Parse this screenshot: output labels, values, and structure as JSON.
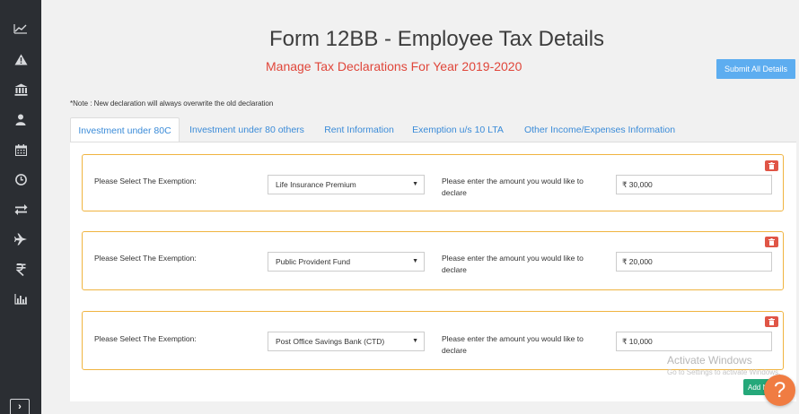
{
  "sidebar": {
    "icons": [
      "chart-line-icon",
      "warning-icon",
      "bank-icon",
      "user-icon",
      "calendar-icon",
      "clock-icon",
      "exchange-icon",
      "plane-icon",
      "rupee-icon",
      "bar-chart-icon"
    ],
    "toggle_glyph": "›"
  },
  "header": {
    "title": "Form 12BB - Employee Tax Details",
    "subtitle": "Manage Tax Declarations For Year 2019-2020",
    "submit_label": "Submit All Details"
  },
  "note": "*Note : New declaration will always overwrite the old declaration",
  "tabs": [
    {
      "label": "Investment under 80C",
      "active": true
    },
    {
      "label": "Investment under 80 others",
      "active": false
    },
    {
      "label": "Rent Information",
      "active": false
    },
    {
      "label": "Exemption u/s 10 LTA",
      "active": false
    },
    {
      "label": "Other Income/Expenses Information",
      "active": false
    }
  ],
  "declarations": [
    {
      "label": "Please Select The Exemption:",
      "selected": "Life Insurance Premium",
      "prompt": "Please enter the amount you would like to declare",
      "amount": "₹ 30,000"
    },
    {
      "label": "Please Select The Exemption:",
      "selected": "Public Provident Fund",
      "prompt": "Please enter the amount you would like to declare",
      "amount": "₹ 20,000"
    },
    {
      "label": "Please Select The Exemption:",
      "selected": "Post Office Savings Bank (CTD)",
      "prompt": "Please enter the amount you would like to declare",
      "amount": "₹ 10,000"
    }
  ],
  "add_label": "Add N",
  "watermark": {
    "title": "Activate Windows",
    "subtitle": "Go to Settings to activate Windows."
  },
  "help_glyph": "?",
  "colors": {
    "accent_blue": "#3a8bd8",
    "subtitle_red": "#e0463a",
    "card_border": "#f0b440",
    "delete_red": "#e05546",
    "add_green": "#25a87a",
    "help_orange": "#f07c42"
  }
}
